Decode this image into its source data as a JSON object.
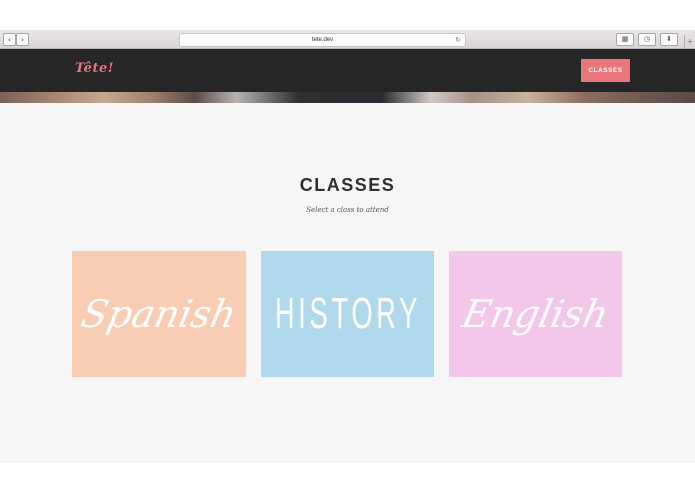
{
  "browser": {
    "url": "tete.dev",
    "back_icon": "chevron-left-icon",
    "forward_icon": "chevron-right-icon",
    "reload_icon": "reload-icon"
  },
  "site": {
    "logo": "Tête!",
    "nav_button": "CLASSES",
    "accent_color": "#e8767a",
    "header_color": "#262626"
  },
  "classes_section": {
    "title": "CLASSES",
    "subtitle": "Select a class to attend",
    "cards": [
      {
        "label": "Spanish",
        "color": "#f9cdb3"
      },
      {
        "label": "HISTORY",
        "color": "#b1d9ec"
      },
      {
        "label": "English",
        "color": "#f3c7ea"
      }
    ]
  }
}
